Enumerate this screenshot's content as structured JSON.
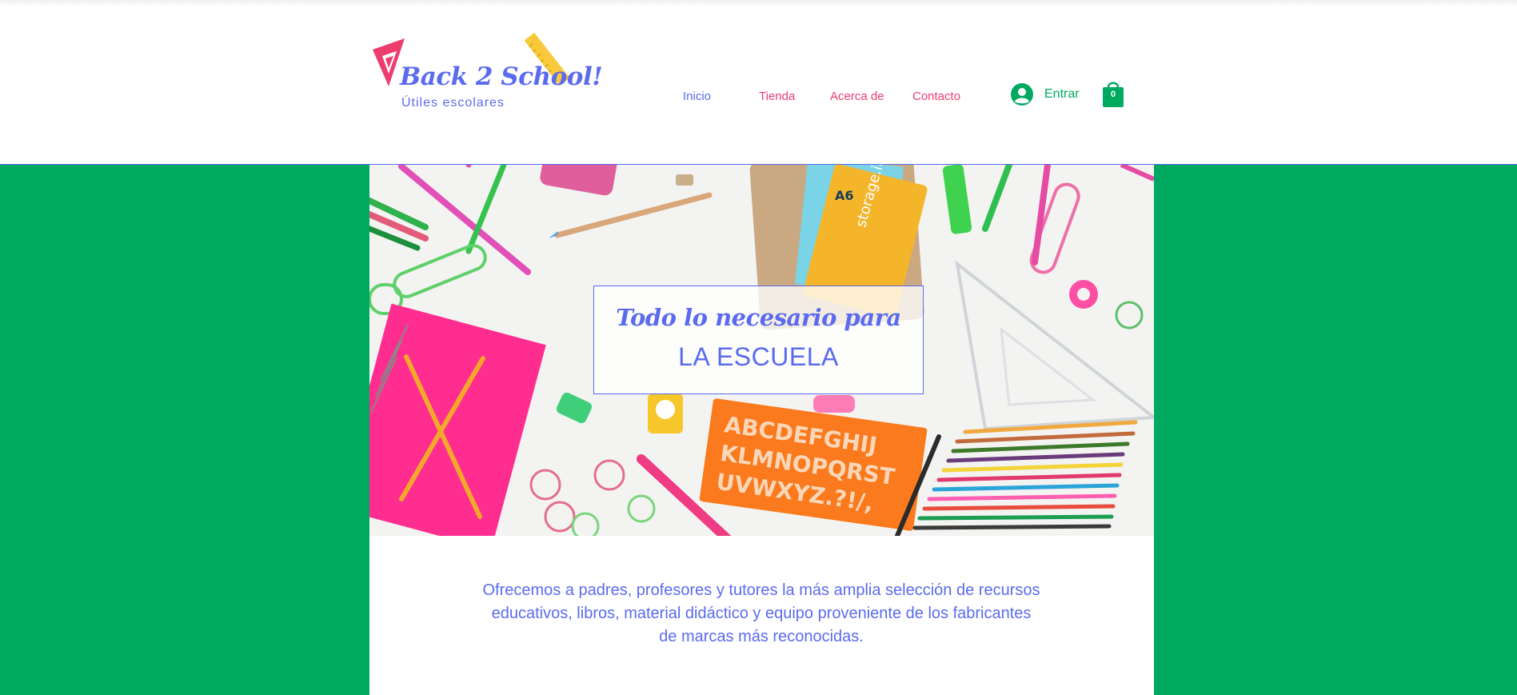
{
  "brand": {
    "title": "Back 2 School!",
    "subtitle": "Útiles escolares"
  },
  "nav": {
    "items": [
      {
        "label": "Inicio"
      },
      {
        "label": "Tienda"
      },
      {
        "label": "Acerca de"
      },
      {
        "label": "Contacto"
      }
    ]
  },
  "login": {
    "label": "Entrar",
    "icon": "user-avatar-icon"
  },
  "cart": {
    "count": "0",
    "icon": "shopping-bag-icon"
  },
  "hero": {
    "line1": "Todo lo necesario para",
    "line2": "LA ESCUELA",
    "stencil_rows": [
      "ABCDEFGHIJ",
      "KLMNOPQRST",
      "UVWXYZ.?!/,"
    ],
    "product_label": "storage.it",
    "book_label": "A6"
  },
  "intro": {
    "text": "Ofrecemos a padres, profesores y tutores la más amplia selección de recursos educativos, libros, material didáctico y equipo proveniente de los fabricantes de marcas más reconocidas."
  },
  "colors": {
    "brand_blue": "#5B6BEE",
    "nav_pink": "#ED3D6E",
    "accent_green": "#00A960",
    "background_green": "#00A960"
  }
}
